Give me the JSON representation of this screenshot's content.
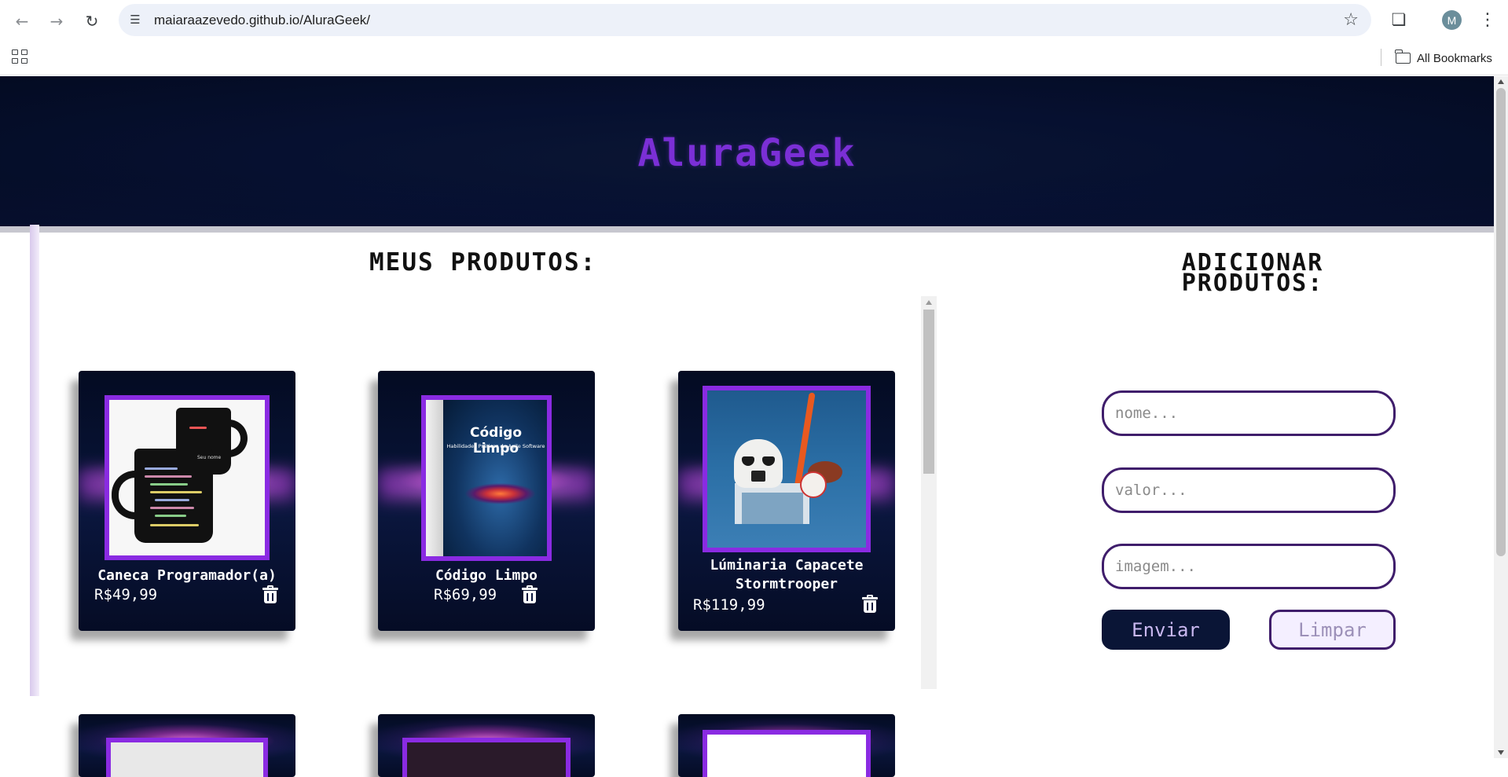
{
  "browser": {
    "url": "maiaraazevedo.github.io/AluraGeek/",
    "profile_initial": "M",
    "bookmarks_label": "All Bookmarks",
    "icons": [
      "back-arrow-icon",
      "forward-arrow-icon",
      "reload-icon",
      "site-info-icon",
      "bookmark-star-icon",
      "extensions-icon",
      "more-menu-icon",
      "apps-grid-icon",
      "folder-icon"
    ]
  },
  "header": {
    "title": "AluraGeek"
  },
  "products_section": {
    "title": "MEUS PRODUTOS:",
    "items": [
      {
        "name": "Caneca Programador(a)",
        "price": "R$49,99",
        "image": "black-coffee-mug-with-code",
        "delete_icon": "trash-icon"
      },
      {
        "name": "Código Limpo",
        "price": "R$69,99",
        "image": "clean-code-book-cover",
        "delete_icon": "trash-icon"
      },
      {
        "name": "Lúminaria Capacete Stormtrooper",
        "price": "R$119,99",
        "image": "stormtrooper-helmet-lamp",
        "delete_icon": "trash-icon"
      }
    ]
  },
  "mug_print": {
    "small_caption": "Seu nome"
  },
  "book": {
    "title": "Código Limpo",
    "subtitle": "Habilidades Práticas do Agile Software"
  },
  "form": {
    "title": "ADICIONAR PRODUTOS:",
    "name_placeholder": "nome...",
    "price_placeholder": "valor...",
    "image_placeholder": "imagem...",
    "submit_label": "Enviar",
    "clear_label": "Limpar"
  },
  "colors": {
    "brand_purple": "#7b2fd6",
    "frame_purple": "#8a2be2",
    "dark_navy": "#0a1536",
    "input_border": "#3f1d6b"
  }
}
